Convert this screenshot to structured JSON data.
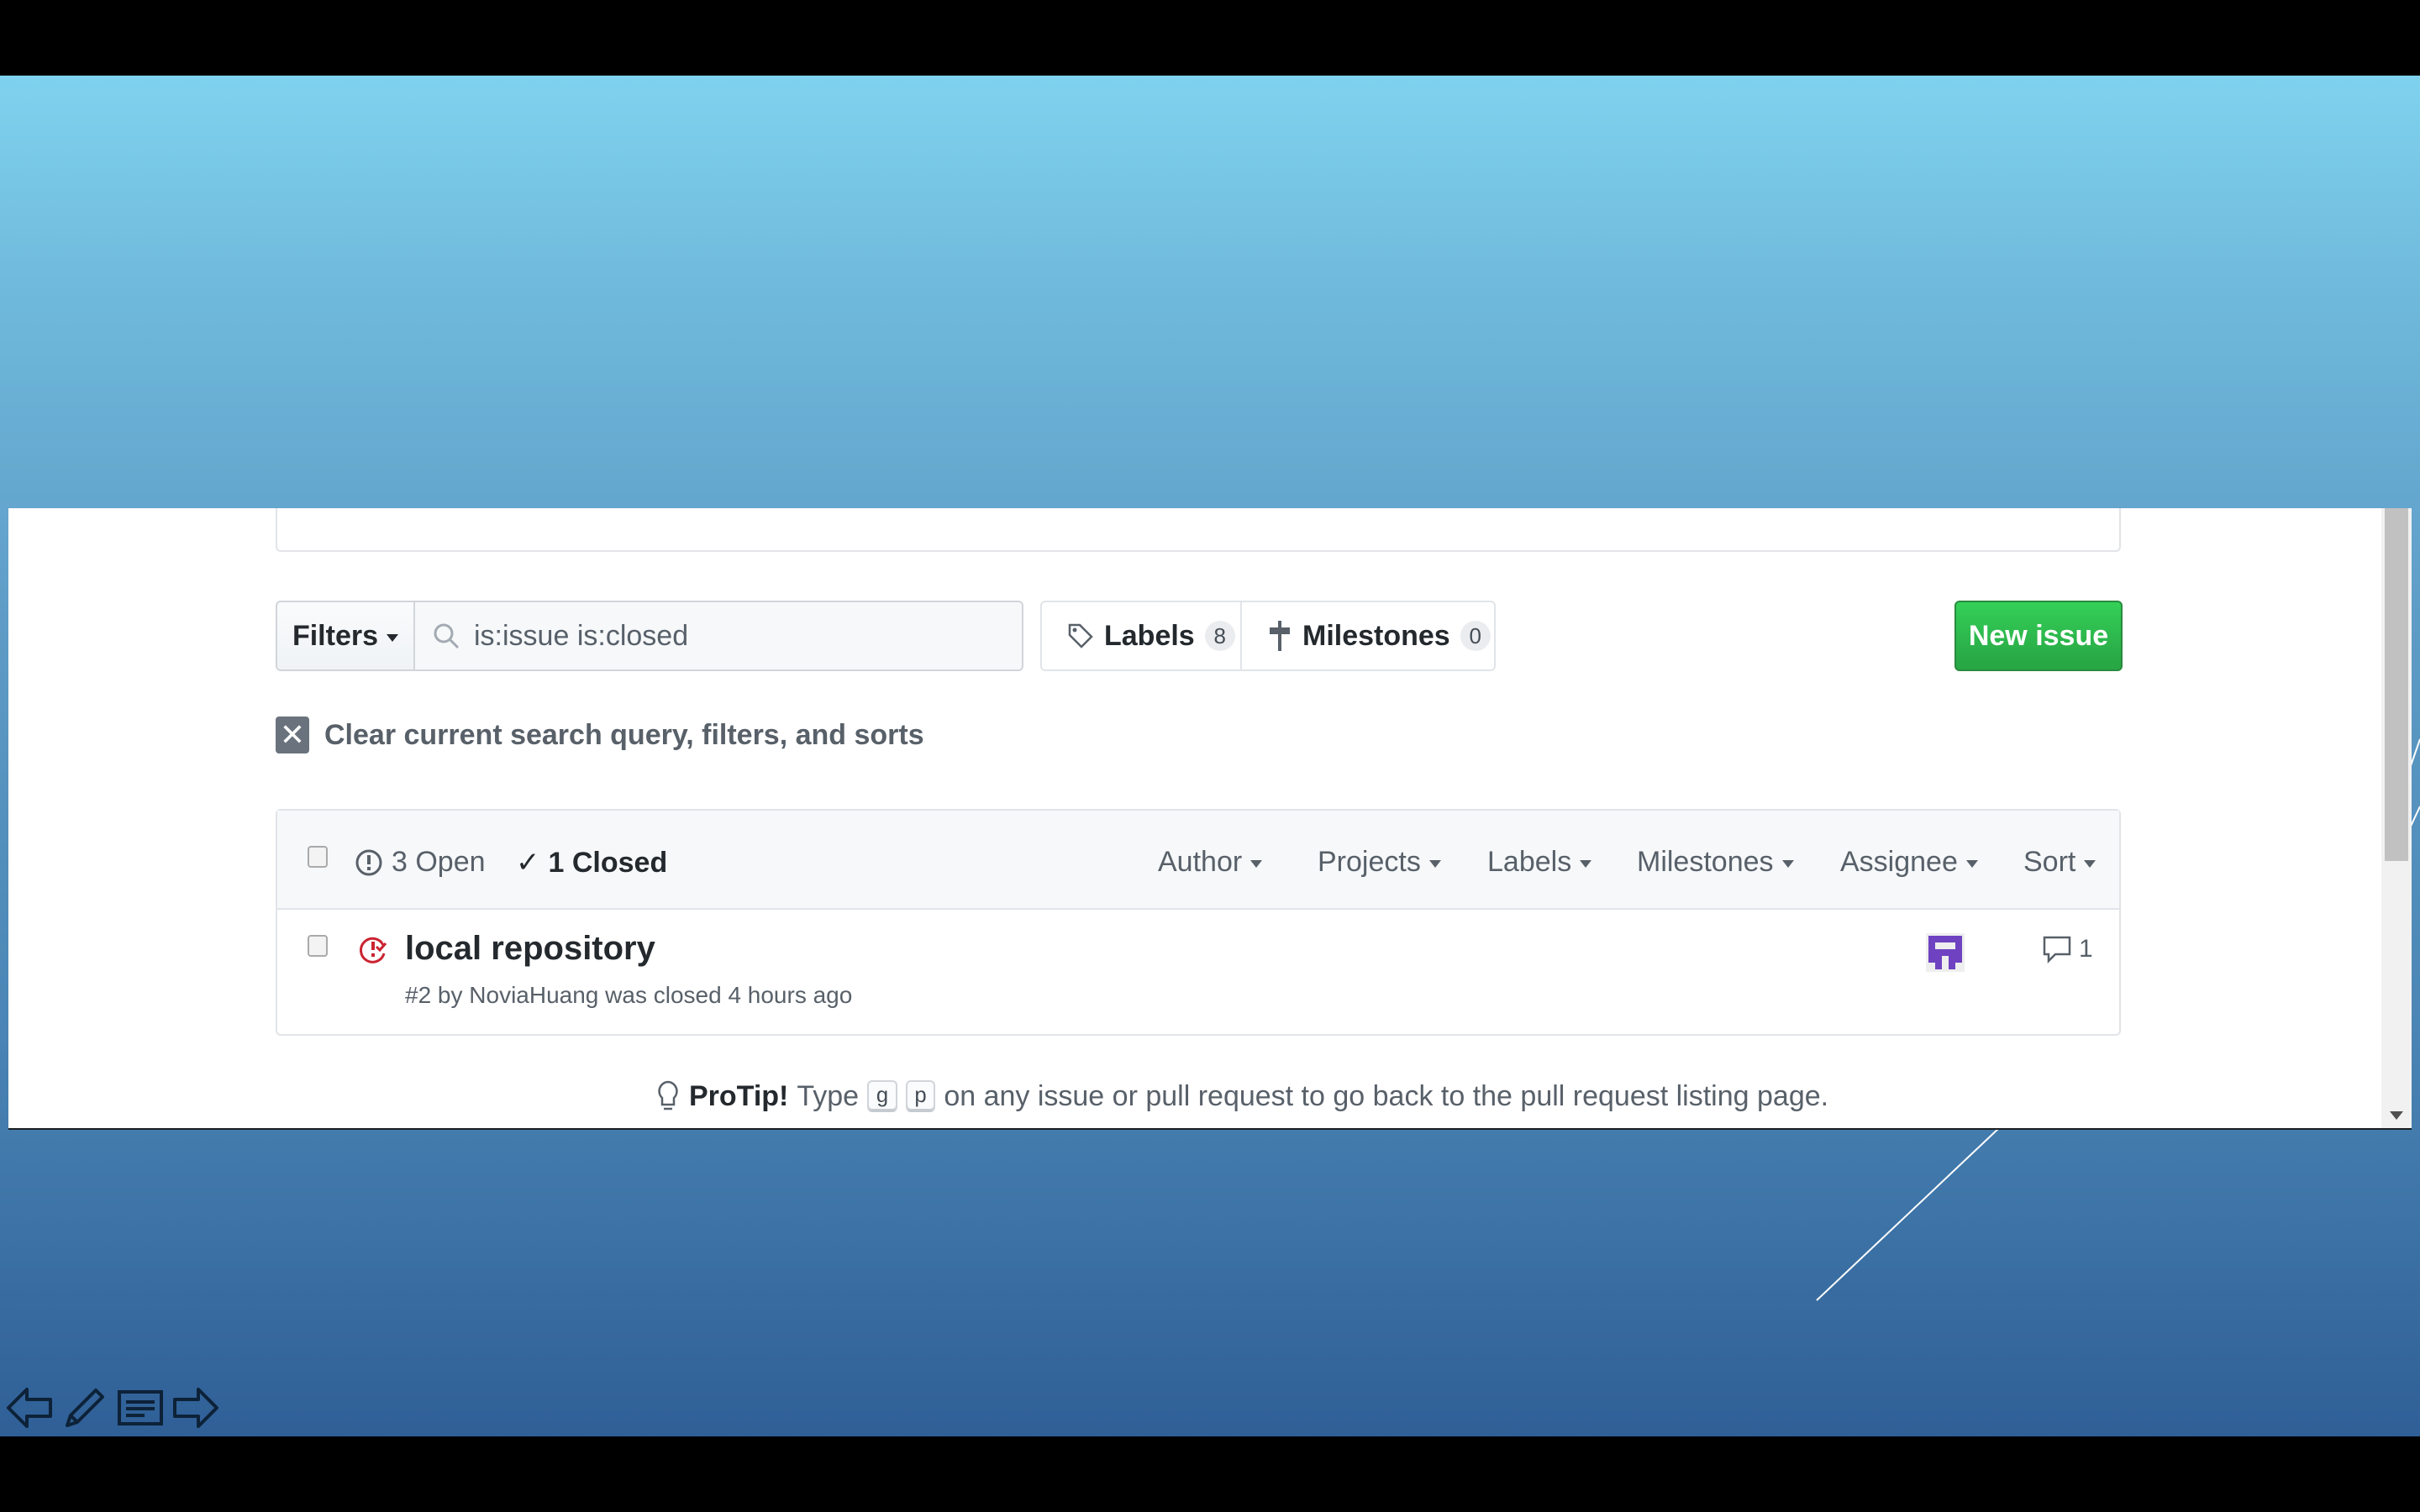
{
  "search": {
    "filters_label": "Filters",
    "query": "is:issue is:closed"
  },
  "toolbar": {
    "labels_label": "Labels",
    "labels_count": "8",
    "milestones_label": "Milestones",
    "milestones_count": "0",
    "new_issue_label": "New issue"
  },
  "clear": {
    "label": "Clear current search query, filters, and sorts"
  },
  "issues_header": {
    "open_label": "3 Open",
    "closed_label": "1 Closed",
    "menus": [
      "Author",
      "Projects",
      "Labels",
      "Milestones",
      "Assignee",
      "Sort"
    ]
  },
  "issues": [
    {
      "title": "local repository",
      "meta": "#2 by NoviaHuang was closed 4 hours ago",
      "comments": "1"
    }
  ],
  "protip": {
    "strong": "ProTip!",
    "prefix": "Type",
    "key1": "g",
    "key2": "p",
    "suffix": "on any issue or pull request to go back to the pull request listing page."
  },
  "colors": {
    "new_issue_green": "#2ea44f",
    "closed_icon_red": "#cb2431",
    "avatar_purple": "#6f42c1"
  }
}
